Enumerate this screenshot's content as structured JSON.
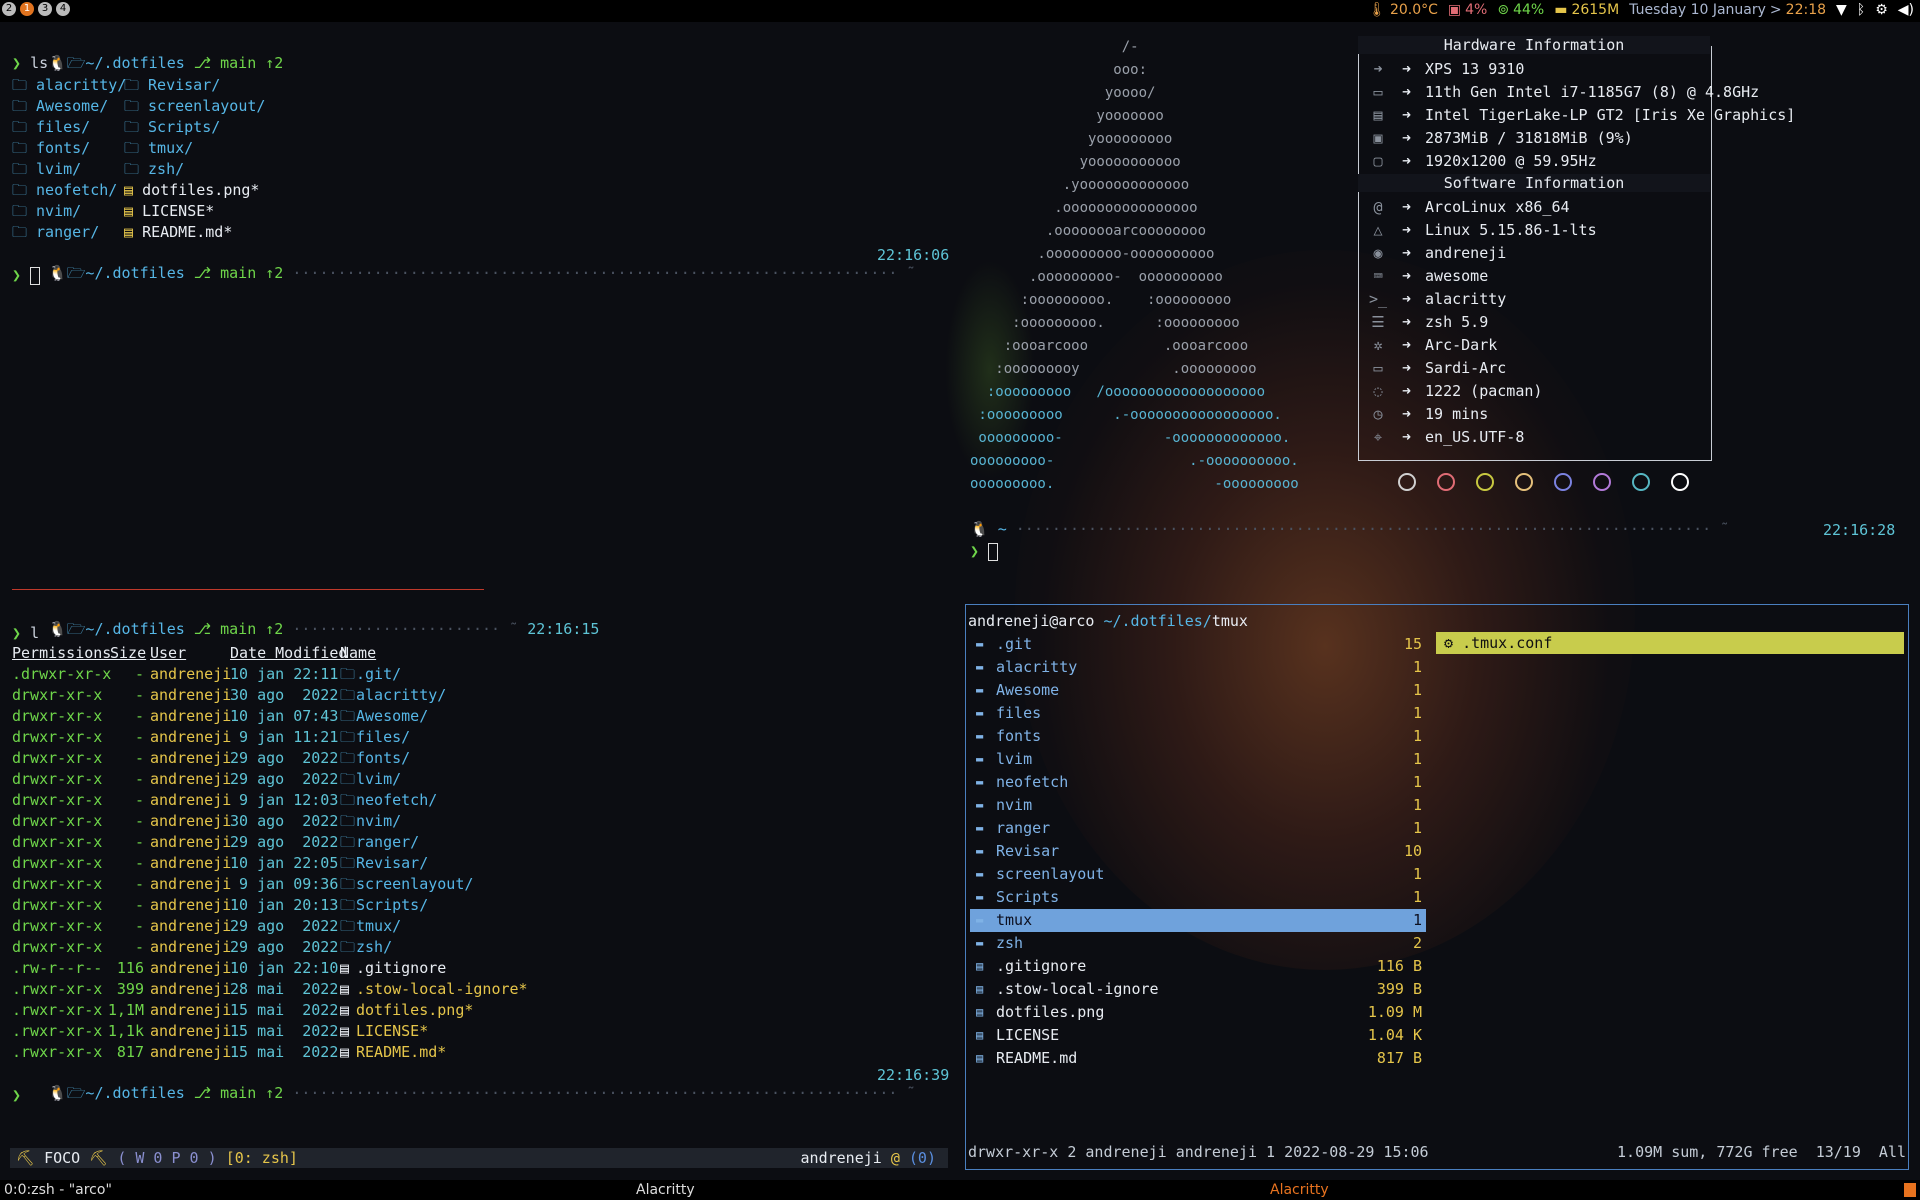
{
  "topbar": {
    "tags": [
      "2",
      "1",
      "3",
      "4"
    ],
    "active_tag": "1",
    "temp": "20.0°C",
    "cpu": "4%",
    "mem_pct": "44%",
    "mem": "2615M",
    "date": "Tuesday 10 January",
    "sep": ">",
    "time": "22:18"
  },
  "pane1": {
    "path": "~/.dotfiles",
    "branch": "main ↑2",
    "cmd": "ls",
    "ls_col1": [
      "alacritty/",
      "Awesome/",
      "files/",
      "fonts/",
      "lvim/",
      "neofetch/",
      "nvim/",
      "ranger/"
    ],
    "ls_col2": [
      "Revisar/",
      "screenlayout/",
      "Scripts/",
      "tmux/",
      "zsh/",
      "dotfiles.png*",
      "LICENSE*",
      "README.md*"
    ],
    "time": "22:16:06"
  },
  "pane2": {
    "path": "~/.dotfiles",
    "branch": "main ↑2",
    "time_top": "22:16:15",
    "cmd": "l",
    "headers": [
      "Permissions",
      "Size",
      "User",
      "Date Modified",
      "Name"
    ],
    "rows": [
      [
        ".drwxr-xr-x",
        "-",
        "andreneji",
        "10 jan 22:11",
        ".git/"
      ],
      [
        "drwxr-xr-x",
        "-",
        "andreneji",
        "30 ago  2022",
        "alacritty/"
      ],
      [
        "drwxr-xr-x",
        "-",
        "andreneji",
        "10 jan 07:43",
        "Awesome/"
      ],
      [
        "drwxr-xr-x",
        "-",
        "andreneji",
        " 9 jan 11:21",
        "files/"
      ],
      [
        "drwxr-xr-x",
        "-",
        "andreneji",
        "29 ago  2022",
        "fonts/"
      ],
      [
        "drwxr-xr-x",
        "-",
        "andreneji",
        "29 ago  2022",
        "lvim/"
      ],
      [
        "drwxr-xr-x",
        "-",
        "andreneji",
        " 9 jan 12:03",
        "neofetch/"
      ],
      [
        "drwxr-xr-x",
        "-",
        "andreneji",
        "30 ago  2022",
        "nvim/"
      ],
      [
        "drwxr-xr-x",
        "-",
        "andreneji",
        "29 ago  2022",
        "ranger/"
      ],
      [
        "drwxr-xr-x",
        "-",
        "andreneji",
        "10 jan 22:05",
        "Revisar/"
      ],
      [
        "drwxr-xr-x",
        "-",
        "andreneji",
        " 9 jan 09:36",
        "screenlayout/"
      ],
      [
        "drwxr-xr-x",
        "-",
        "andreneji",
        "10 jan 20:13",
        "Scripts/"
      ],
      [
        "drwxr-xr-x",
        "-",
        "andreneji",
        "29 ago  2022",
        "tmux/"
      ],
      [
        "drwxr-xr-x",
        "-",
        "andreneji",
        "29 ago  2022",
        "zsh/"
      ],
      [
        ".rw-r--r--",
        "116",
        "andreneji",
        "10 jan 22:10",
        ".gitignore"
      ],
      [
        ".rwxr-xr-x",
        "399",
        "andreneji",
        "28 mai  2022",
        ".stow-local-ignore*"
      ],
      [
        ".rwxr-xr-x",
        "1,1M",
        "andreneji",
        "15 mai  2022",
        "dotfiles.png*"
      ],
      [
        ".rwxr-xr-x",
        "1,1k",
        "andreneji",
        "15 mai  2022",
        "LICENSE*"
      ],
      [
        ".rwxr-xr-x",
        "817",
        "andreneji",
        "15 mai  2022",
        "README.md*"
      ]
    ],
    "time_bottom": "22:16:39"
  },
  "neofetch": {
    "ascii": [
      "                  /-",
      "                 ooo:",
      "                yoooo/",
      "               yooooooo",
      "              yooooooooo",
      "             yooooooooooo",
      "           .yooooooooooooo",
      "          .oooooooooooooooo",
      "         .oooooooarcoooooooo",
      "        .ooooooooo-oooooooooo",
      "       .ooooooooo-  oooooooooo",
      "      :ooooooooo.    :ooooooooo",
      "     :ooooooooo.      :ooooooooo",
      "    :oooarcooo         .oooarcooo",
      "   :ooooooooy           .ooooooooo",
      "  :ooooooooo   /ooooooooooooooooooo",
      " :ooooooooo      .-ooooooooooooooooo.",
      " ooooooooo-            -ooooooooooooo.",
      "ooooooooo-                .-oooooooooo.",
      "ooooooooo.                   -ooooooooo"
    ],
    "hw_title": "Hardware Information",
    "sw_title": "Software Information",
    "hw": [
      {
        "icon": "➜",
        "value": "XPS 13 9310"
      },
      {
        "icon": "▭",
        "value": "11th Gen Intel i7-1185G7 (8) @ 4.8GHz"
      },
      {
        "icon": "▤",
        "value": "Intel TigerLake-LP GT2 [Iris Xe Graphics]"
      },
      {
        "icon": "▣",
        "value": "2873MiB / 31818MiB (9%)"
      },
      {
        "icon": "▢",
        "value": "1920x1200 @ 59.95Hz"
      }
    ],
    "sw": [
      {
        "icon": "@",
        "value": "ArcoLinux x86_64"
      },
      {
        "icon": "△",
        "value": "Linux 5.15.86-1-lts"
      },
      {
        "icon": "◉",
        "value": "andreneji"
      },
      {
        "icon": "⌨",
        "value": "awesome"
      },
      {
        "icon": ">_",
        "value": "alacritty"
      },
      {
        "icon": "☰",
        "value": "zsh 5.9"
      },
      {
        "icon": "✲",
        "value": "Arc-Dark"
      },
      {
        "icon": "▭",
        "value": "Sardi-Arc"
      },
      {
        "icon": "◌",
        "value": "1222 (pacman)"
      },
      {
        "icon": "◷",
        "value": "19 mins"
      },
      {
        "icon": "⌖",
        "value": "en_US.UTF-8"
      }
    ],
    "colors": [
      "#d0d0d0",
      "#e06c75",
      "#c8c840",
      "#e5c07b",
      "#7b82e0",
      "#b27ad8",
      "#56b6c2",
      "#ffffff"
    ],
    "prompt_path": "~",
    "time": "22:16:28"
  },
  "ranger": {
    "header_user": "andreneji@arco",
    "header_path": " ~/.dotfiles/",
    "header_dir": "tmux",
    "items": [
      {
        "name": ".git",
        "size": "15",
        "type": "dir"
      },
      {
        "name": "alacritty",
        "size": "1",
        "type": "dir"
      },
      {
        "name": "Awesome",
        "size": "1",
        "type": "dir"
      },
      {
        "name": "files",
        "size": "1",
        "type": "dir"
      },
      {
        "name": "fonts",
        "size": "1",
        "type": "dir"
      },
      {
        "name": "lvim",
        "size": "1",
        "type": "dir"
      },
      {
        "name": "neofetch",
        "size": "1",
        "type": "dir"
      },
      {
        "name": "nvim",
        "size": "1",
        "type": "dir"
      },
      {
        "name": "ranger",
        "size": "1",
        "type": "dir"
      },
      {
        "name": "Revisar",
        "size": "10",
        "type": "dir"
      },
      {
        "name": "screenlayout",
        "size": "1",
        "type": "dir"
      },
      {
        "name": "Scripts",
        "size": "1",
        "type": "dir"
      },
      {
        "name": "tmux",
        "size": "1",
        "type": "dir"
      },
      {
        "name": "zsh",
        "size": "2",
        "type": "dir"
      },
      {
        "name": ".gitignore",
        "size": "116 B",
        "type": "file"
      },
      {
        "name": ".stow-local-ignore",
        "size": "399 B",
        "type": "file"
      },
      {
        "name": "dotfiles.png",
        "size": "1.09 M",
        "type": "file"
      },
      {
        "name": "LICENSE",
        "size": "1.04 K",
        "type": "file"
      },
      {
        "name": "README.md",
        "size": "817 B",
        "type": "file"
      }
    ],
    "selected_index": 12,
    "preview_item": ".tmux.conf",
    "status_left": "drwxr-xr-x 2 andreneji andreneji 1 2022-08-29 15:06",
    "status_right": "1.09M sum, 772G free  13/19  All"
  },
  "tmux": {
    "left": "FOCO",
    "mode": "( W 0 P 0 )",
    "window": "[0: zsh]",
    "user": "andreneji",
    "at": "@",
    "count": "(0)"
  },
  "bottombar": {
    "left": "0:0:zsh - \"arco\"",
    "center": "Alacritty",
    "right": "Alacritty"
  }
}
